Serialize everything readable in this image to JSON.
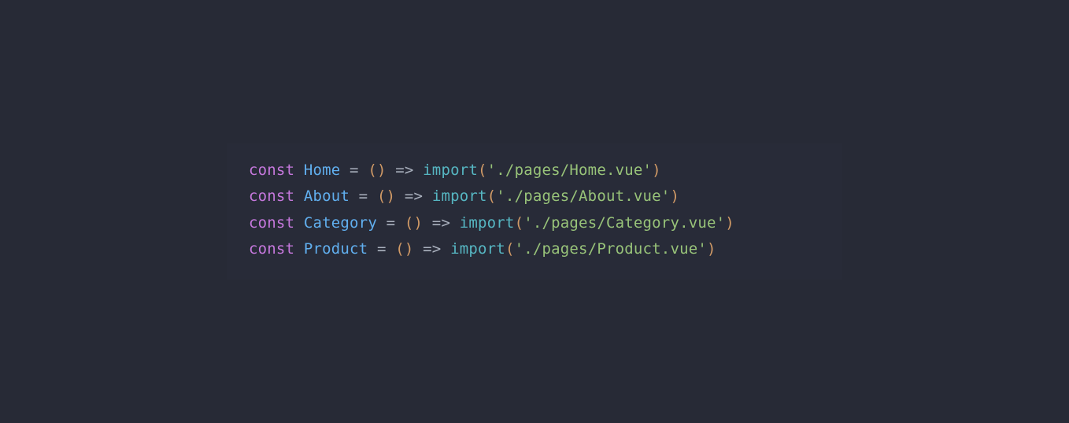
{
  "code": {
    "lines": [
      {
        "keyword": "const",
        "identifier": "Home",
        "func": "import",
        "argument": "'./pages/Home.vue'"
      },
      {
        "keyword": "const",
        "identifier": "About",
        "func": "import",
        "argument": "'./pages/About.vue'"
      },
      {
        "keyword": "const",
        "identifier": "Category",
        "func": "import",
        "argument": "'./pages/Category.vue'"
      },
      {
        "keyword": "const",
        "identifier": "Product",
        "func": "import",
        "argument": "'./pages/Product.vue'"
      }
    ]
  },
  "tokens": {
    "assign": " = ",
    "lparen": "(",
    "rparen": ")",
    "arrow": " => ",
    "space": " "
  }
}
